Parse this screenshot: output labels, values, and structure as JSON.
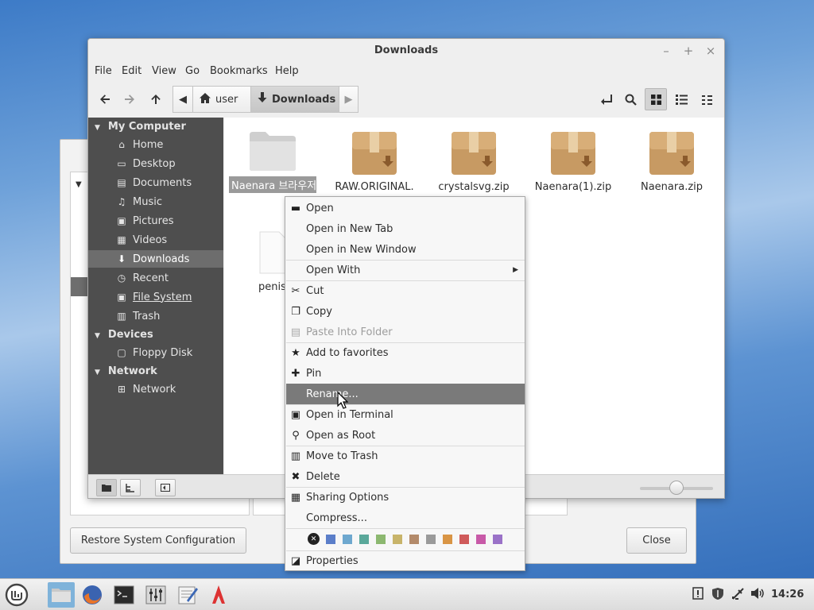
{
  "window": {
    "title": "Downloads",
    "controls": {
      "minimize": "–",
      "maximize": "+",
      "close": "×"
    }
  },
  "menubar": [
    "File",
    "Edit",
    "View",
    "Go",
    "Bookmarks",
    "Help"
  ],
  "breadcrumb": {
    "home": "user",
    "current": "Downloads"
  },
  "sidebar": {
    "sections": [
      {
        "title": "My Computer",
        "items": [
          {
            "label": "Home",
            "icon": "home-icon"
          },
          {
            "label": "Desktop",
            "icon": "desktop-icon"
          },
          {
            "label": "Documents",
            "icon": "documents-icon"
          },
          {
            "label": "Music",
            "icon": "music-icon"
          },
          {
            "label": "Pictures",
            "icon": "pictures-icon"
          },
          {
            "label": "Videos",
            "icon": "videos-icon"
          },
          {
            "label": "Downloads",
            "icon": "downloads-icon",
            "selected": true
          },
          {
            "label": "Recent",
            "icon": "recent-icon"
          },
          {
            "label": "File System",
            "icon": "filesystem-icon"
          },
          {
            "label": "Trash",
            "icon": "trash-icon"
          }
        ]
      },
      {
        "title": "Devices",
        "items": [
          {
            "label": "Floppy Disk",
            "icon": "floppy-icon"
          }
        ]
      },
      {
        "title": "Network",
        "items": [
          {
            "label": "Network",
            "icon": "network-icon"
          }
        ]
      }
    ]
  },
  "files": [
    {
      "name": "Naenara 브라우저",
      "type": "folder",
      "selected": true
    },
    {
      "name": "RAW.ORIGINAL.",
      "type": "archive"
    },
    {
      "name": "crystalsvg.zip",
      "type": "archive"
    },
    {
      "name": "Naenara(1).zip",
      "type": "archive"
    },
    {
      "name": "Naenara.zip",
      "type": "archive"
    },
    {
      "name": "penis.",
      "type": "file"
    }
  ],
  "context_menu": {
    "items": [
      {
        "label": "Open",
        "icon": "folder-open-icon"
      },
      {
        "label": "Open in New Tab"
      },
      {
        "label": "Open in New Window"
      },
      {
        "label": "Open With",
        "submenu": true
      },
      {
        "label": "Cut",
        "icon": "scissors-icon"
      },
      {
        "label": "Copy",
        "icon": "copy-icon"
      },
      {
        "label": "Paste Into Folder",
        "icon": "paste-icon",
        "disabled": true
      },
      {
        "label": "Add to favorites",
        "icon": "star-icon"
      },
      {
        "label": "Pin",
        "icon": "pin-icon"
      },
      {
        "label": "Rename...",
        "highlighted": true
      },
      {
        "label": "Open in Terminal",
        "icon": "terminal-icon"
      },
      {
        "label": "Open as Root",
        "icon": "key-icon"
      },
      {
        "label": "Move to Trash",
        "icon": "trash-icon"
      },
      {
        "label": "Delete",
        "icon": "delete-icon"
      },
      {
        "label": "Sharing Options",
        "icon": "share-icon"
      },
      {
        "label": "Compress...",
        "icon": ""
      },
      {
        "label": "Properties",
        "icon": "properties-icon"
      }
    ],
    "tag_colors": [
      "#5b7ec9",
      "#6ea8cf",
      "#5aa89a",
      "#8cb870",
      "#c8b46a",
      "#b38a6a",
      "#9a9a9a",
      "#d99545",
      "#cf5a5a",
      "#c85aa8",
      "#9a72c8"
    ]
  },
  "background_dialog": {
    "restore_label": "Restore System Configuration",
    "close_label": "Close"
  },
  "taskbar": {
    "clock": "14:26",
    "apps": [
      "menu-icon",
      "files-icon",
      "firefox-icon",
      "terminal-icon",
      "mixer-icon",
      "editor-icon",
      "app-icon"
    ]
  }
}
